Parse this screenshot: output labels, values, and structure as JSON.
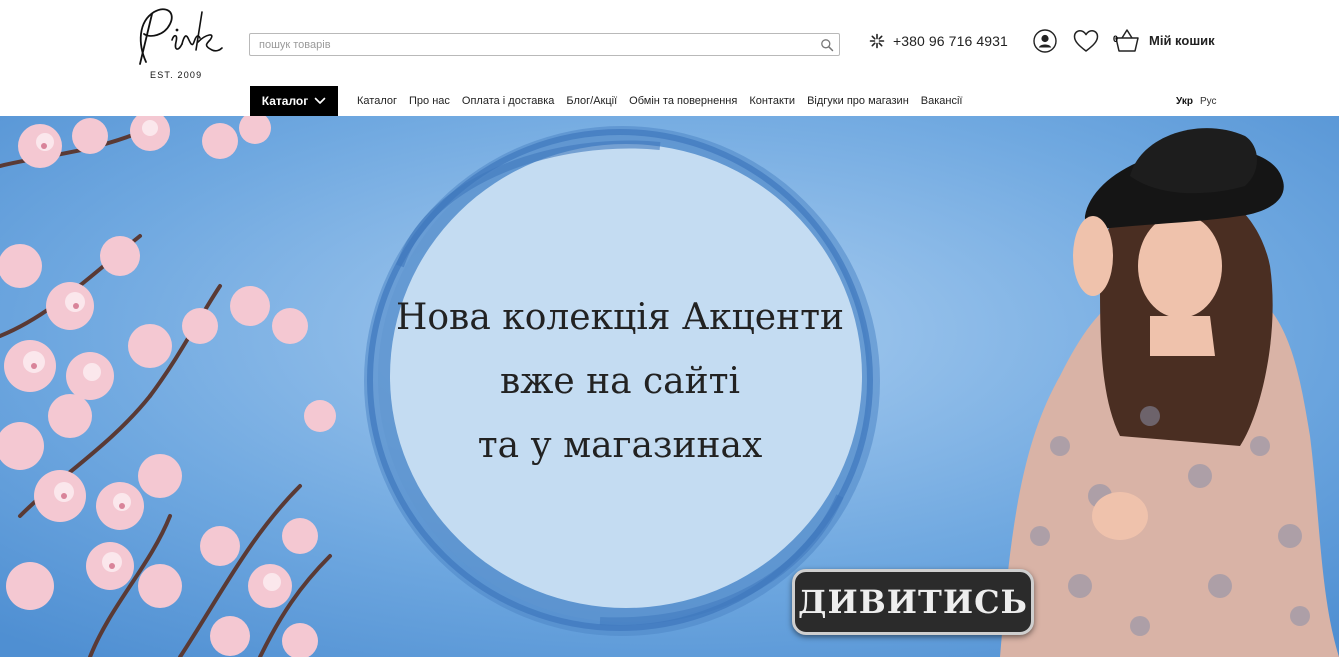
{
  "header": {
    "logo_text": "Pink",
    "logo_est": "EST. 2009",
    "search_placeholder": "пошук товарів",
    "phone": "+380 96 716 4931",
    "cart_count": "0",
    "cart_label": "Мій кошик"
  },
  "nav": {
    "catalog_button": "Каталог",
    "items": [
      {
        "label": "Каталог"
      },
      {
        "label": "Про нас"
      },
      {
        "label": "Оплата і доставка"
      },
      {
        "label": "Блог/Акції"
      },
      {
        "label": "Обмін та повернення"
      },
      {
        "label": "Контакти"
      },
      {
        "label": "Відгуки про магазин"
      },
      {
        "label": "Вакансії"
      }
    ],
    "languages": [
      {
        "label": "Укр",
        "active": true
      },
      {
        "label": "Рус",
        "active": false
      }
    ]
  },
  "hero": {
    "line1": "Нова колекція Акценти",
    "line2": "вже на сайті",
    "line3": "та у магазинах",
    "button": "ДИВИТИСЬ"
  },
  "icons": {
    "search": "search-icon",
    "phone": "phone-icon",
    "user": "user-icon",
    "wishlist": "heart-icon",
    "cart": "basket-icon",
    "dropdown": "chevron-down-icon"
  },
  "colors": {
    "accent_black": "#000000",
    "sky": "#6aa6e0",
    "circle_ring": "#4f86c6",
    "circle_fill": "#c4dcf2",
    "blossom": "#f4c8d2"
  }
}
